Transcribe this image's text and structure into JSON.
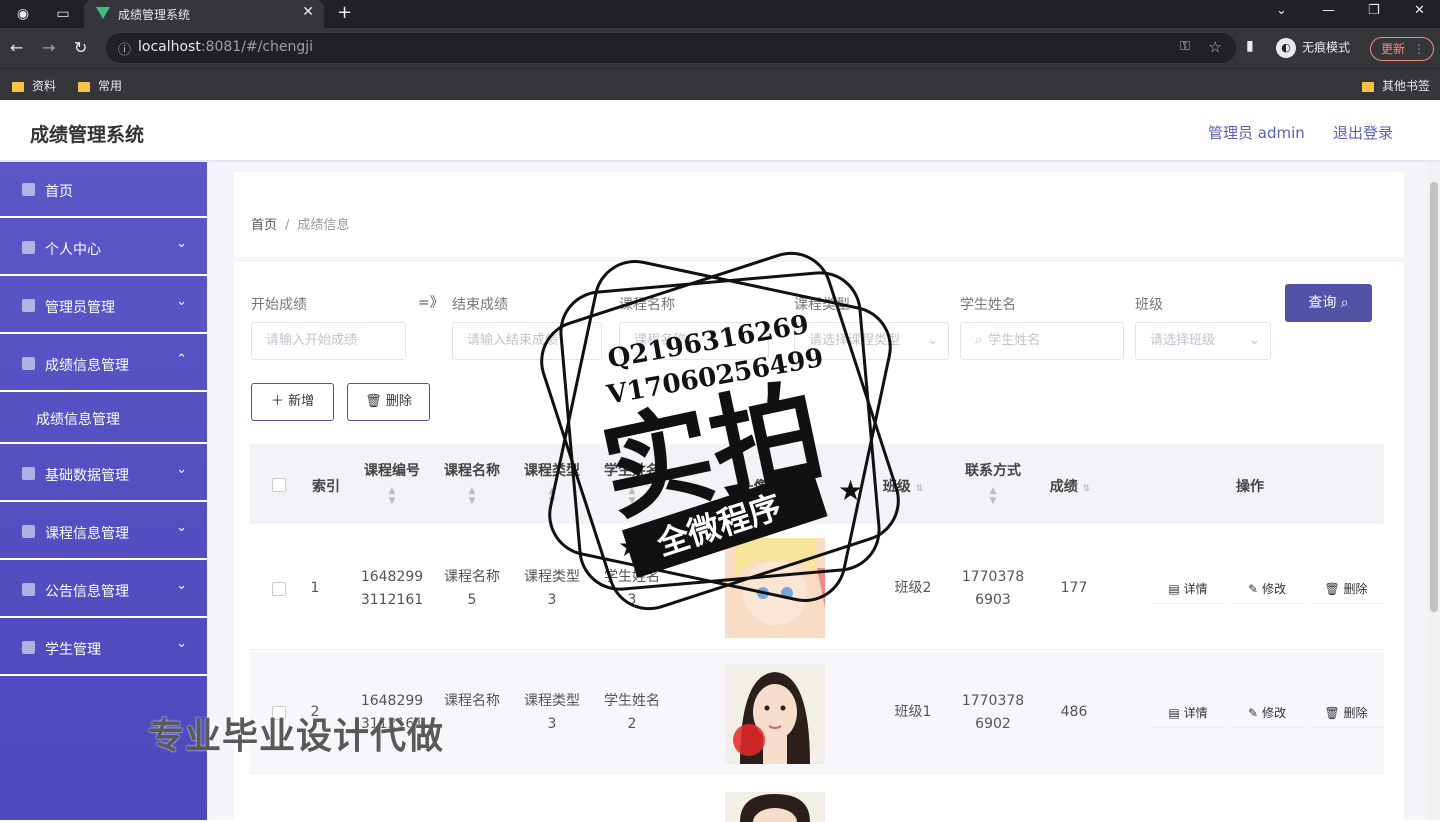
{
  "browser": {
    "tab_title": "成绩管理系统",
    "url_host": "localhost",
    "url_rest": ":8081/#/chengji",
    "incognito_label": "无痕模式",
    "update_label": "更新",
    "bookmarks": [
      "资料",
      "常用"
    ],
    "other_bookmarks": "其他书签"
  },
  "header": {
    "app_name": "成绩管理系统",
    "admin": "管理员 admin",
    "logout": "退出登录"
  },
  "sidebar": {
    "items": [
      {
        "label": "首页"
      },
      {
        "label": "个人中心"
      },
      {
        "label": "管理员管理"
      },
      {
        "label": "成绩信息管理"
      },
      {
        "label": "成绩信息管理"
      },
      {
        "label": "基础数据管理"
      },
      {
        "label": "课程信息管理"
      },
      {
        "label": "公告信息管理"
      },
      {
        "label": "学生管理"
      }
    ]
  },
  "breadcrumb": {
    "home": "首页",
    "sep": "/",
    "current": "成绩信息"
  },
  "filters": {
    "start_label": "开始成绩",
    "start_placeholder": "请输入开始成绩",
    "arrow": "=》",
    "end_label": "结束成绩",
    "end_placeholder": "请输入结束成绩",
    "course_name_label": "课程名称",
    "course_name_placeholder": "课程名称",
    "course_type_label": "课程类型",
    "course_type_placeholder": "请选择课程类型",
    "student_name_label": "学生姓名",
    "student_name_placeholder": "学生姓名",
    "class_label": "班级",
    "class_placeholder": "请选择班级",
    "search_label": "查询"
  },
  "actions": {
    "add": "新增",
    "delete": "删除"
  },
  "table": {
    "columns": [
      "索引",
      "课程编号",
      "课程名称",
      "课程类型",
      "学生姓名",
      "头像",
      "班级",
      "联系方式",
      "成绩",
      "操作"
    ],
    "rows": [
      {
        "idx": "1",
        "code_a": "1648299",
        "code_b": "3112161",
        "name_a": "课程名称",
        "name_b": "5",
        "type_a": "课程类型",
        "type_b": "3",
        "stu_a": "学生姓名",
        "stu_b": "3",
        "cls": "班级2",
        "phone_a": "1770378",
        "phone_b": "6903",
        "score": "177"
      },
      {
        "idx": "2",
        "code_a": "1648299",
        "code_b": "3112161",
        "name_a": "课程名称",
        "name_b": "",
        "type_a": "课程类型",
        "type_b": "3",
        "stu_a": "学生姓名",
        "stu_b": "2",
        "cls": "班级1",
        "phone_a": "1770378",
        "phone_b": "6902",
        "score": "486"
      }
    ],
    "ops": {
      "detail": "详情",
      "edit": "修改",
      "remove": "删除"
    }
  },
  "overlay": {
    "stamp_q": "Q2196316269",
    "stamp_v": "V17060256499",
    "stamp_big": "实拍",
    "stamp_banner": "全微程序",
    "watermark": "专业毕业设计代做"
  }
}
